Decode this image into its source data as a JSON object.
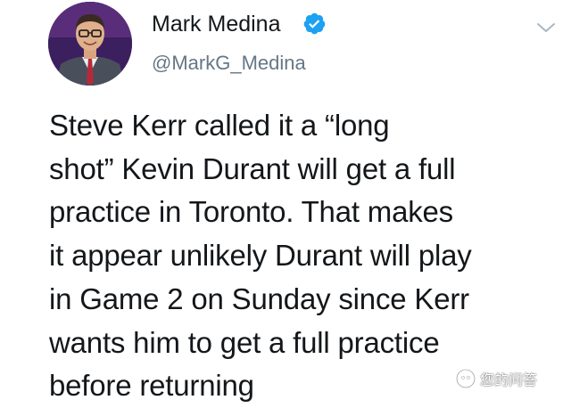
{
  "author": {
    "display_name": "Mark Medina",
    "handle": "@MarkG_Medina",
    "verified": true,
    "avatar_icon": "profile-avatar",
    "verified_color": "#1da1f2"
  },
  "tweet": {
    "lines": [
      "Steve Kerr called it a  “long",
      "shot”  Kevin Durant will get a full",
      "practice in Toronto. That makes",
      "it appear unlikely Durant will play",
      "in Game 2 on Sunday since Kerr",
      "wants him to get a full practice",
      "before returning"
    ]
  },
  "menu": {
    "icon": "chevron-down-icon"
  },
  "watermark": {
    "text": "您的问答",
    "icon": "watermark-logo"
  }
}
